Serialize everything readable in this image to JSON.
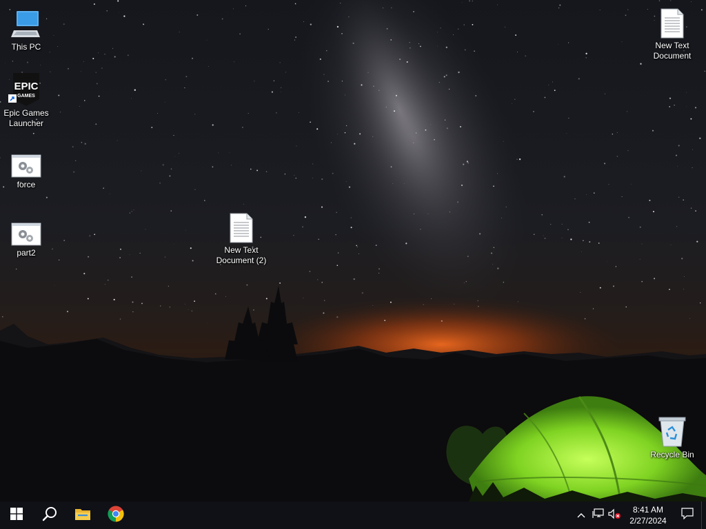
{
  "desktop": {
    "icons": [
      {
        "label": "This PC"
      },
      {
        "label": "Epic Games Launcher",
        "logo_text_1": "EPIC",
        "logo_text_2": "GAMES"
      },
      {
        "label": "force"
      },
      {
        "label": "part2"
      },
      {
        "label": "New Text Document (2)"
      },
      {
        "label": "New Text Document"
      },
      {
        "label": "Recycle Bin"
      }
    ]
  },
  "taskbar": {
    "pinned": [
      {
        "icon": "windows-start-icon"
      },
      {
        "icon": "search-icon"
      },
      {
        "icon": "file-explorer-icon"
      },
      {
        "icon": "chrome-icon"
      }
    ],
    "tray": {
      "icons": [
        "chevron-up-icon",
        "network-icon",
        "volume-muted-icon"
      ],
      "time": "8:41 AM",
      "date": "2/27/2024"
    }
  },
  "colors": {
    "taskbar": "#101116",
    "tent": "#8be02a",
    "horizon_glow": "#e0561c",
    "folder": "#f1c23f"
  }
}
